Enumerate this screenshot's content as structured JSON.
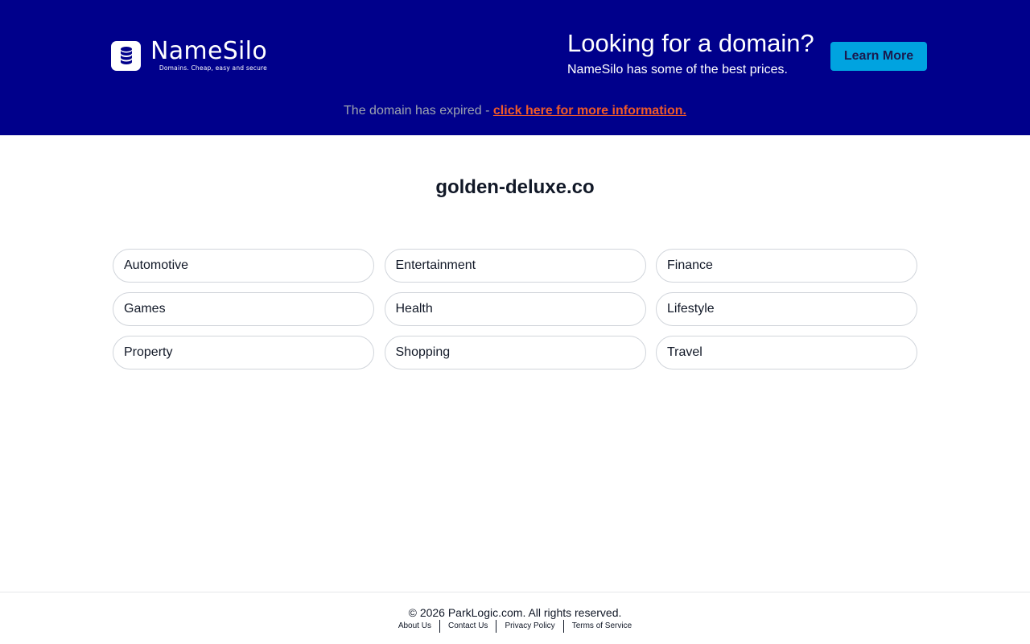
{
  "header": {
    "logo_name": "NameSilo",
    "logo_tagline": "Domains. Cheap, easy and secure",
    "logo_icon": "database-icon",
    "promo_title": "Looking for a domain?",
    "promo_subtitle": "NameSilo has some of the best prices.",
    "learn_more_label": "Learn More",
    "expired_text": "The domain has expired - ",
    "expired_link": "click here for more information."
  },
  "main": {
    "domain": "golden-deluxe.co",
    "categories": [
      "Automotive",
      "Entertainment",
      "Finance",
      "Games",
      "Health",
      "Lifestyle",
      "Property",
      "Shopping",
      "Travel"
    ]
  },
  "footer": {
    "copyright": "© 2026 ParkLogic.com. All rights reserved.",
    "links": [
      "About Us",
      "Contact Us",
      "Privacy Policy",
      "Terms of Service"
    ]
  },
  "colors": {
    "banner": "#00008b",
    "button": "#00a3e0",
    "link": "#f05a28"
  }
}
